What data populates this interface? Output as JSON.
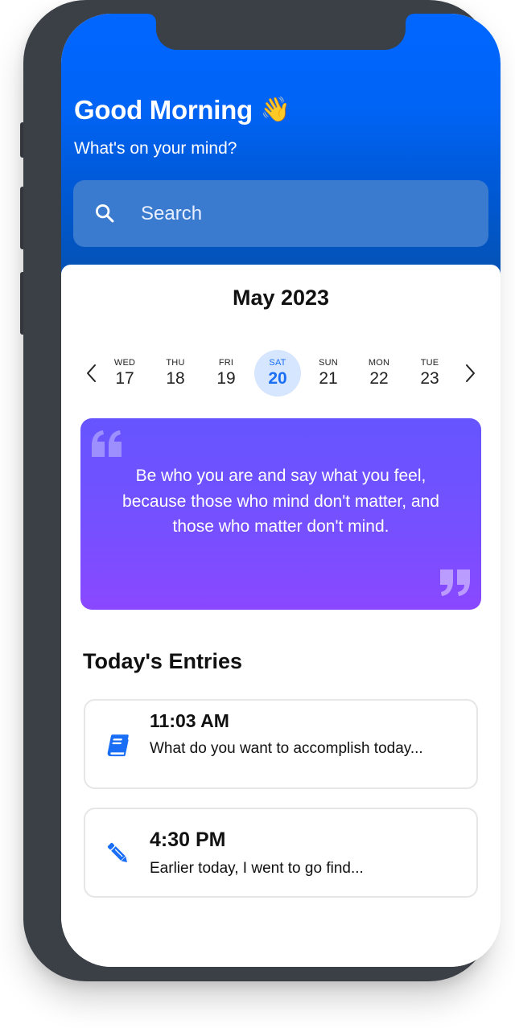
{
  "header": {
    "greeting": "Good Morning",
    "greeting_emoji": "👋",
    "subtitle": "What's on your mind?",
    "search_placeholder": "Search"
  },
  "calendar": {
    "month_label": "May 2023",
    "prev_icon": "chevron-left-icon",
    "next_icon": "chevron-right-icon",
    "days": [
      {
        "dow": "WED",
        "num": "17",
        "selected": false
      },
      {
        "dow": "THU",
        "num": "18",
        "selected": false
      },
      {
        "dow": "FRI",
        "num": "19",
        "selected": false
      },
      {
        "dow": "SAT",
        "num": "20",
        "selected": true
      },
      {
        "dow": "SUN",
        "num": "21",
        "selected": false
      },
      {
        "dow": "MON",
        "num": "22",
        "selected": false
      },
      {
        "dow": "TUE",
        "num": "23",
        "selected": false
      }
    ]
  },
  "quote": {
    "text": "Be who you are and say what you feel, because those who mind don't matter, and those who matter don't mind."
  },
  "entries": {
    "title": "Today's Entries",
    "items": [
      {
        "time": "11:03 AM",
        "preview": "What do you want to accomplish today...",
        "icon": "book-icon"
      },
      {
        "time": "4:30 PM",
        "preview": "Earlier today, I went to go find...",
        "icon": "pencil-icon"
      }
    ]
  },
  "colors": {
    "header_blue": "#0066ff",
    "accent_blue": "#1a6ef5",
    "selected_day_bg": "#d6e6ff",
    "quote_gradient_top": "#6655ff",
    "quote_gradient_bottom": "#8a48ff",
    "frame": "#3b3f46"
  }
}
